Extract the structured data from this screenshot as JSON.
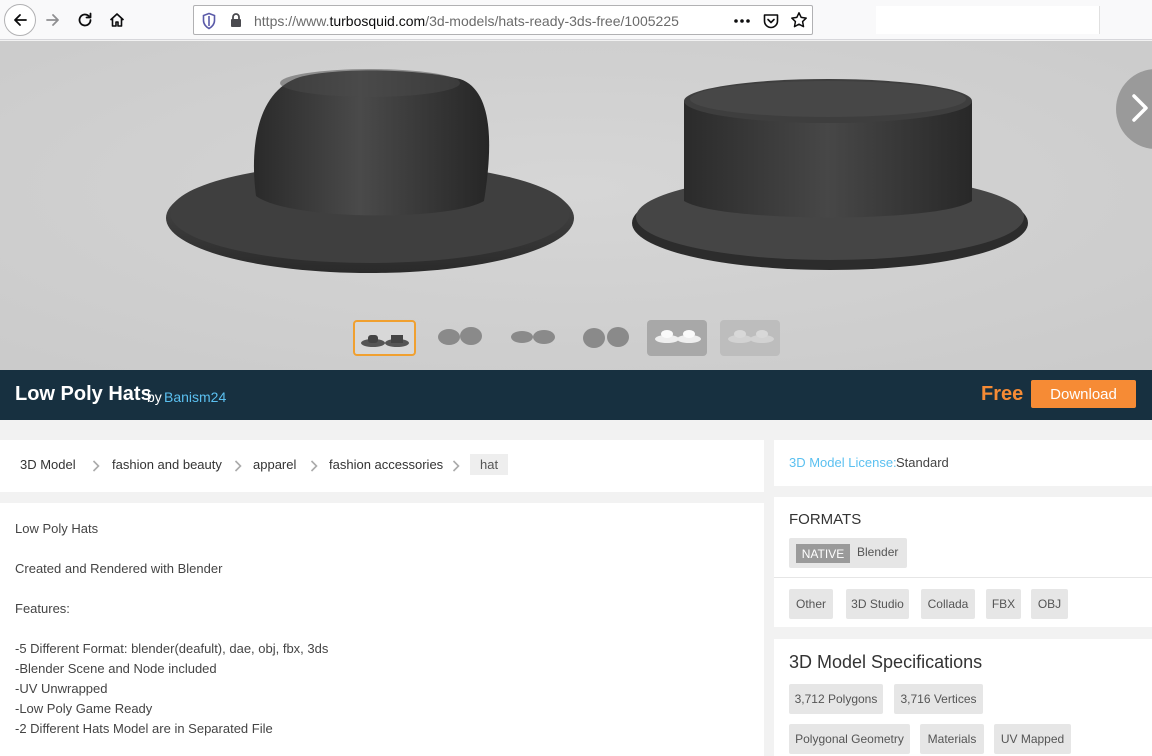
{
  "browser": {
    "url_prefix": "https://www.",
    "url_domain": "turbosquid.com",
    "url_path": "/3d-models/hats-ready-3ds-free/1005225"
  },
  "product": {
    "title": "Low Poly Hats",
    "by_label": "by",
    "author": "Banism24",
    "price": "Free",
    "download_label": "Download"
  },
  "breadcrumbs": [
    "3D Model",
    "fashion and beauty",
    "apparel",
    "fashion accessories",
    "hat"
  ],
  "description": [
    "Low Poly Hats",
    "Created and Rendered with Blender",
    "Features:",
    "-5 Different Format: blender(deafult), dae, obj, fbx, 3ds",
    "-Blender Scene and Node included",
    "-UV Unwrapped",
    "-Low Poly Game Ready",
    "-2 Different Hats Model are in Separated File"
  ],
  "license": {
    "label": "3D Model License:",
    "value": "Standard"
  },
  "formats": {
    "heading": "FORMATS",
    "native_tag": "NATIVE",
    "native_name": "Blender",
    "other": [
      "Other",
      "3D Studio",
      "Collada",
      "FBX",
      "OBJ"
    ]
  },
  "specs": {
    "heading": "3D Model Specifications",
    "row1": [
      "3,712 Polygons",
      "3,716 Vertices"
    ],
    "row2": [
      "Polygonal Geometry",
      "Materials",
      "UV Mapped"
    ]
  },
  "colors": {
    "title_bar": "#173040",
    "accent_orange": "#f68b35",
    "link_blue": "#5bc0f0"
  }
}
